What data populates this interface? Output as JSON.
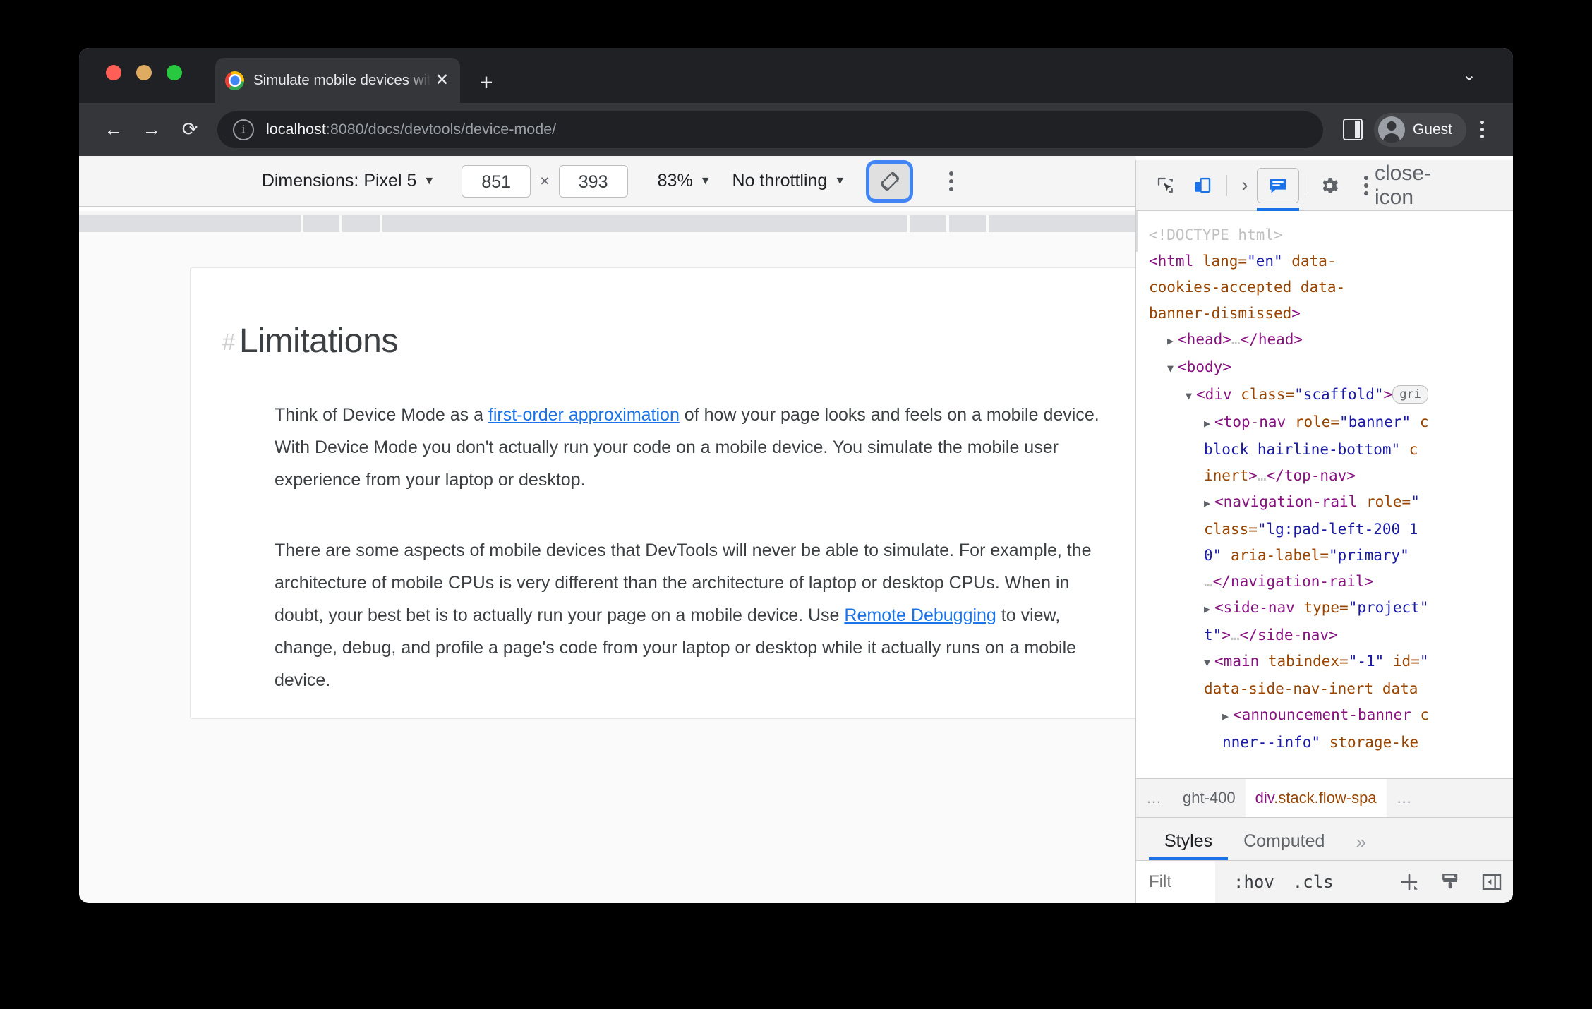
{
  "browser": {
    "tab": {
      "title": "Simulate mobile devices with D",
      "close_icon": "close-icon",
      "new_tab_icon": "plus-icon"
    },
    "window_chevron": "chevron-down-icon",
    "nav": {
      "back": "←",
      "forward": "→",
      "reload": "⟳"
    },
    "omnibox": {
      "info_icon": "info-icon",
      "url_host": "localhost",
      "url_path": ":8080/docs/devtools/device-mode/"
    },
    "side_panel_icon": "side-panel-icon",
    "profile": {
      "name": "Guest",
      "avatar": "avatar-icon"
    },
    "menu_icon": "kebab-menu-icon"
  },
  "device_toolbar": {
    "dimensions_label": "Dimensions: Pixel 5",
    "dimensions_caret": "▼",
    "width": "851",
    "multiply": "×",
    "height": "393",
    "zoom": "83%",
    "zoom_caret": "▼",
    "throttling": "No throttling",
    "throttling_caret": "▼",
    "rotate_icon": "rotate-device-icon",
    "more_icon": "kebab-menu-icon"
  },
  "page": {
    "heading_hash": "#",
    "heading": "Limitations",
    "paragraph1_a": "Think of Device Mode as a ",
    "paragraph1_link": "first-order approximation",
    "paragraph1_b": " of how your page looks and feels on a mobile device. With Device Mode you don't actually run your code on a mobile device. You simulate the mobile user experience from your laptop or desktop.",
    "paragraph2_a": "There are some aspects of mobile devices that DevTools will never be able to simulate. For example, the architecture of mobile CPUs is very different than the architecture of laptop or desktop CPUs. When in doubt, your best bet is to actually run your page on a mobile device. Use ",
    "paragraph2_link": "Remote Debugging",
    "paragraph2_b": " to view, change, debug, and profile a page's code from your laptop or desktop while it actually runs on a mobile device."
  },
  "devtools": {
    "toolbar": {
      "inspect_icon": "inspect-element-icon",
      "device_toggle_icon": "toggle-device-toolbar-icon",
      "overflow_icon": "›",
      "panel_icon": "issues-message-icon",
      "settings_icon": "gear-icon",
      "more_icon": "kebab-menu-icon",
      "close_icon": "close-icon"
    },
    "dom": [
      {
        "indent": 1,
        "triangle": "",
        "parts": [
          {
            "cls": "doctype",
            "t": "<!DOCTYPE html>"
          }
        ]
      },
      {
        "indent": 1,
        "triangle": "",
        "parts": [
          {
            "cls": "tag",
            "t": "<html"
          },
          {
            "cls": "attr",
            "t": " lang="
          },
          {
            "cls": "val",
            "t": "\"en\""
          },
          {
            "cls": "attr",
            "t": " data-"
          }
        ]
      },
      {
        "indent": 1,
        "triangle": "",
        "parts": [
          {
            "cls": "attr",
            "t": "cookies-accepted data-"
          }
        ]
      },
      {
        "indent": 1,
        "triangle": "",
        "parts": [
          {
            "cls": "attr",
            "t": "banner-dismissed"
          },
          {
            "cls": "tag",
            "t": ">"
          }
        ]
      },
      {
        "indent": 2,
        "triangle": "▶",
        "parts": [
          {
            "cls": "tag",
            "t": "<head>"
          },
          {
            "cls": "doctype",
            "t": "…"
          },
          {
            "cls": "tag",
            "t": "</head>"
          }
        ]
      },
      {
        "indent": 2,
        "triangle": "▼",
        "parts": [
          {
            "cls": "tag",
            "t": "<body>"
          }
        ]
      },
      {
        "indent": 3,
        "triangle": "▼",
        "parts": [
          {
            "cls": "tag",
            "t": "<div "
          },
          {
            "cls": "attr",
            "t": "class="
          },
          {
            "cls": "val",
            "t": "\"scaffold\""
          },
          {
            "cls": "tag",
            "t": ">"
          },
          {
            "cls": "badge",
            "t": "gri"
          }
        ]
      },
      {
        "indent": 4,
        "triangle": "▶",
        "parts": [
          {
            "cls": "tag",
            "t": "<top-nav "
          },
          {
            "cls": "attr",
            "t": "role="
          },
          {
            "cls": "val",
            "t": "\"banner\""
          },
          {
            "cls": "attr",
            "t": " c"
          }
        ]
      },
      {
        "indent": 4,
        "triangle": "",
        "parts": [
          {
            "cls": "val",
            "t": "block hairline-bottom\""
          },
          {
            "cls": "attr",
            "t": " c"
          }
        ]
      },
      {
        "indent": 4,
        "triangle": "",
        "parts": [
          {
            "cls": "attr",
            "t": "inert"
          },
          {
            "cls": "tag",
            "t": ">"
          },
          {
            "cls": "doctype",
            "t": "…"
          },
          {
            "cls": "tag",
            "t": "</top-nav>"
          }
        ]
      },
      {
        "indent": 4,
        "triangle": "▶",
        "parts": [
          {
            "cls": "tag",
            "t": "<navigation-rail "
          },
          {
            "cls": "attr",
            "t": "role="
          },
          {
            "cls": "val",
            "t": "\""
          }
        ]
      },
      {
        "indent": 4,
        "triangle": "",
        "parts": [
          {
            "cls": "attr",
            "t": "class="
          },
          {
            "cls": "val",
            "t": "\"lg:pad-left-200 1"
          }
        ]
      },
      {
        "indent": 4,
        "triangle": "",
        "parts": [
          {
            "cls": "val",
            "t": "0\""
          },
          {
            "cls": "attr",
            "t": " aria-label="
          },
          {
            "cls": "val",
            "t": "\"primary\""
          }
        ]
      },
      {
        "indent": 4,
        "triangle": "",
        "parts": [
          {
            "cls": "doctype",
            "t": "…"
          },
          {
            "cls": "tag",
            "t": "</navigation-rail>"
          }
        ]
      },
      {
        "indent": 4,
        "triangle": "▶",
        "parts": [
          {
            "cls": "tag",
            "t": "<side-nav "
          },
          {
            "cls": "attr",
            "t": "type="
          },
          {
            "cls": "val",
            "t": "\"project\""
          }
        ]
      },
      {
        "indent": 4,
        "triangle": "",
        "parts": [
          {
            "cls": "val",
            "t": "t\""
          },
          {
            "cls": "tag",
            "t": ">"
          },
          {
            "cls": "doctype",
            "t": "…"
          },
          {
            "cls": "tag",
            "t": "</side-nav>"
          }
        ]
      },
      {
        "indent": 4,
        "triangle": "▼",
        "parts": [
          {
            "cls": "tag",
            "t": "<main "
          },
          {
            "cls": "attr",
            "t": "tabindex="
          },
          {
            "cls": "val",
            "t": "\"-1\""
          },
          {
            "cls": "attr",
            "t": " id="
          },
          {
            "cls": "val",
            "t": "\""
          }
        ]
      },
      {
        "indent": 4,
        "triangle": "",
        "parts": [
          {
            "cls": "attr",
            "t": "data-side-nav-inert data"
          }
        ]
      },
      {
        "indent": 5,
        "triangle": "▶",
        "parts": [
          {
            "cls": "tag",
            "t": "<announcement-banner "
          },
          {
            "cls": "attr",
            "t": "c"
          }
        ]
      },
      {
        "indent": 5,
        "triangle": "",
        "parts": [
          {
            "cls": "val",
            "t": "nner--info\""
          },
          {
            "cls": "attr",
            "t": " storage-ke"
          }
        ]
      }
    ],
    "breadcrumbs": [
      {
        "type": "dots",
        "text": "…"
      },
      {
        "type": "plain",
        "text": "ght-400"
      },
      {
        "type": "selected",
        "el": "div",
        "rest": ".stack.flow-spa"
      },
      {
        "type": "dots",
        "text": "…"
      }
    ],
    "style_tabs": [
      {
        "label": "Styles",
        "active": true
      },
      {
        "label": "Computed",
        "active": false
      },
      {
        "label": "»",
        "active": false
      }
    ],
    "filter": {
      "placeholder": "Filt",
      "hov": ":hov",
      "cls": ".cls",
      "add_icon": "plus-icon",
      "brush_icon": "paint-brush-icon",
      "sidebar_icon": "toggle-sidebar-icon"
    }
  }
}
